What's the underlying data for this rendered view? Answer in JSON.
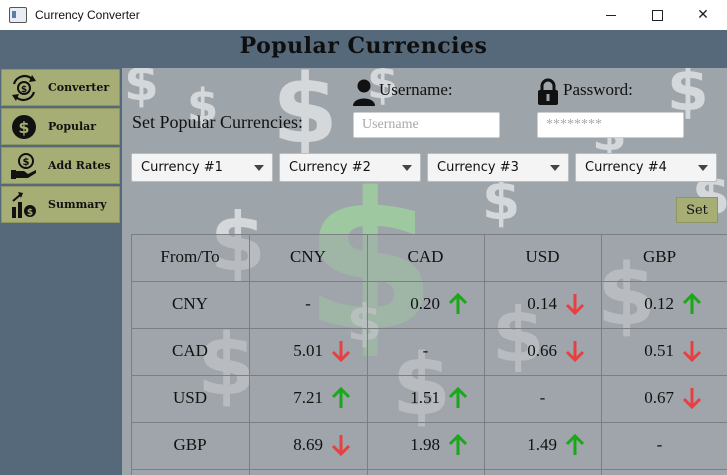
{
  "window": {
    "title": "Currency Converter",
    "minimize_icon": "minimize-icon",
    "maximize_icon": "maximize-icon",
    "close_icon": "close-icon"
  },
  "header": {
    "title": "Popular Currencies"
  },
  "sidebar": {
    "items": [
      {
        "label": "Converter",
        "icon": "exchange-icon"
      },
      {
        "label": "Popular",
        "icon": "dollar-coin-icon"
      },
      {
        "label": "Add Rates",
        "icon": "hand-coin-icon"
      },
      {
        "label": "Summary",
        "icon": "growth-chart-icon"
      }
    ]
  },
  "form": {
    "set_label": "Set Popular Currencies:",
    "username_label": "Username:",
    "username_placeholder": "Username",
    "password_label": "Password:",
    "password_value": "********",
    "currency_selects": [
      "Currency #1",
      "Currency #2",
      "Currency #3",
      "Currency #4"
    ],
    "set_button": "Set"
  },
  "table": {
    "corner": "From/To",
    "columns": [
      "CNY",
      "CAD",
      "USD",
      "GBP"
    ],
    "rows": [
      {
        "from": "CNY",
        "cells": [
          {
            "value": "-",
            "trend": "none"
          },
          {
            "value": "0.20",
            "trend": "up"
          },
          {
            "value": "0.14",
            "trend": "down"
          },
          {
            "value": "0.12",
            "trend": "up"
          }
        ]
      },
      {
        "from": "CAD",
        "cells": [
          {
            "value": "5.01",
            "trend": "down"
          },
          {
            "value": "-",
            "trend": "none"
          },
          {
            "value": "0.66",
            "trend": "down"
          },
          {
            "value": "0.51",
            "trend": "down"
          }
        ]
      },
      {
        "from": "USD",
        "cells": [
          {
            "value": "7.21",
            "trend": "up"
          },
          {
            "value": "1.51",
            "trend": "up"
          },
          {
            "value": "-",
            "trend": "none"
          },
          {
            "value": "0.67",
            "trend": "down"
          }
        ]
      },
      {
        "from": "GBP",
        "cells": [
          {
            "value": "8.69",
            "trend": "down"
          },
          {
            "value": "1.98",
            "trend": "up"
          },
          {
            "value": "1.49",
            "trend": "up"
          },
          {
            "value": "-",
            "trend": "none"
          }
        ]
      }
    ]
  },
  "colors": {
    "header_bg": "#56697a",
    "nav_button": "#a6ad75",
    "trend_up": "#1aa81a",
    "trend_down": "#e84040"
  }
}
